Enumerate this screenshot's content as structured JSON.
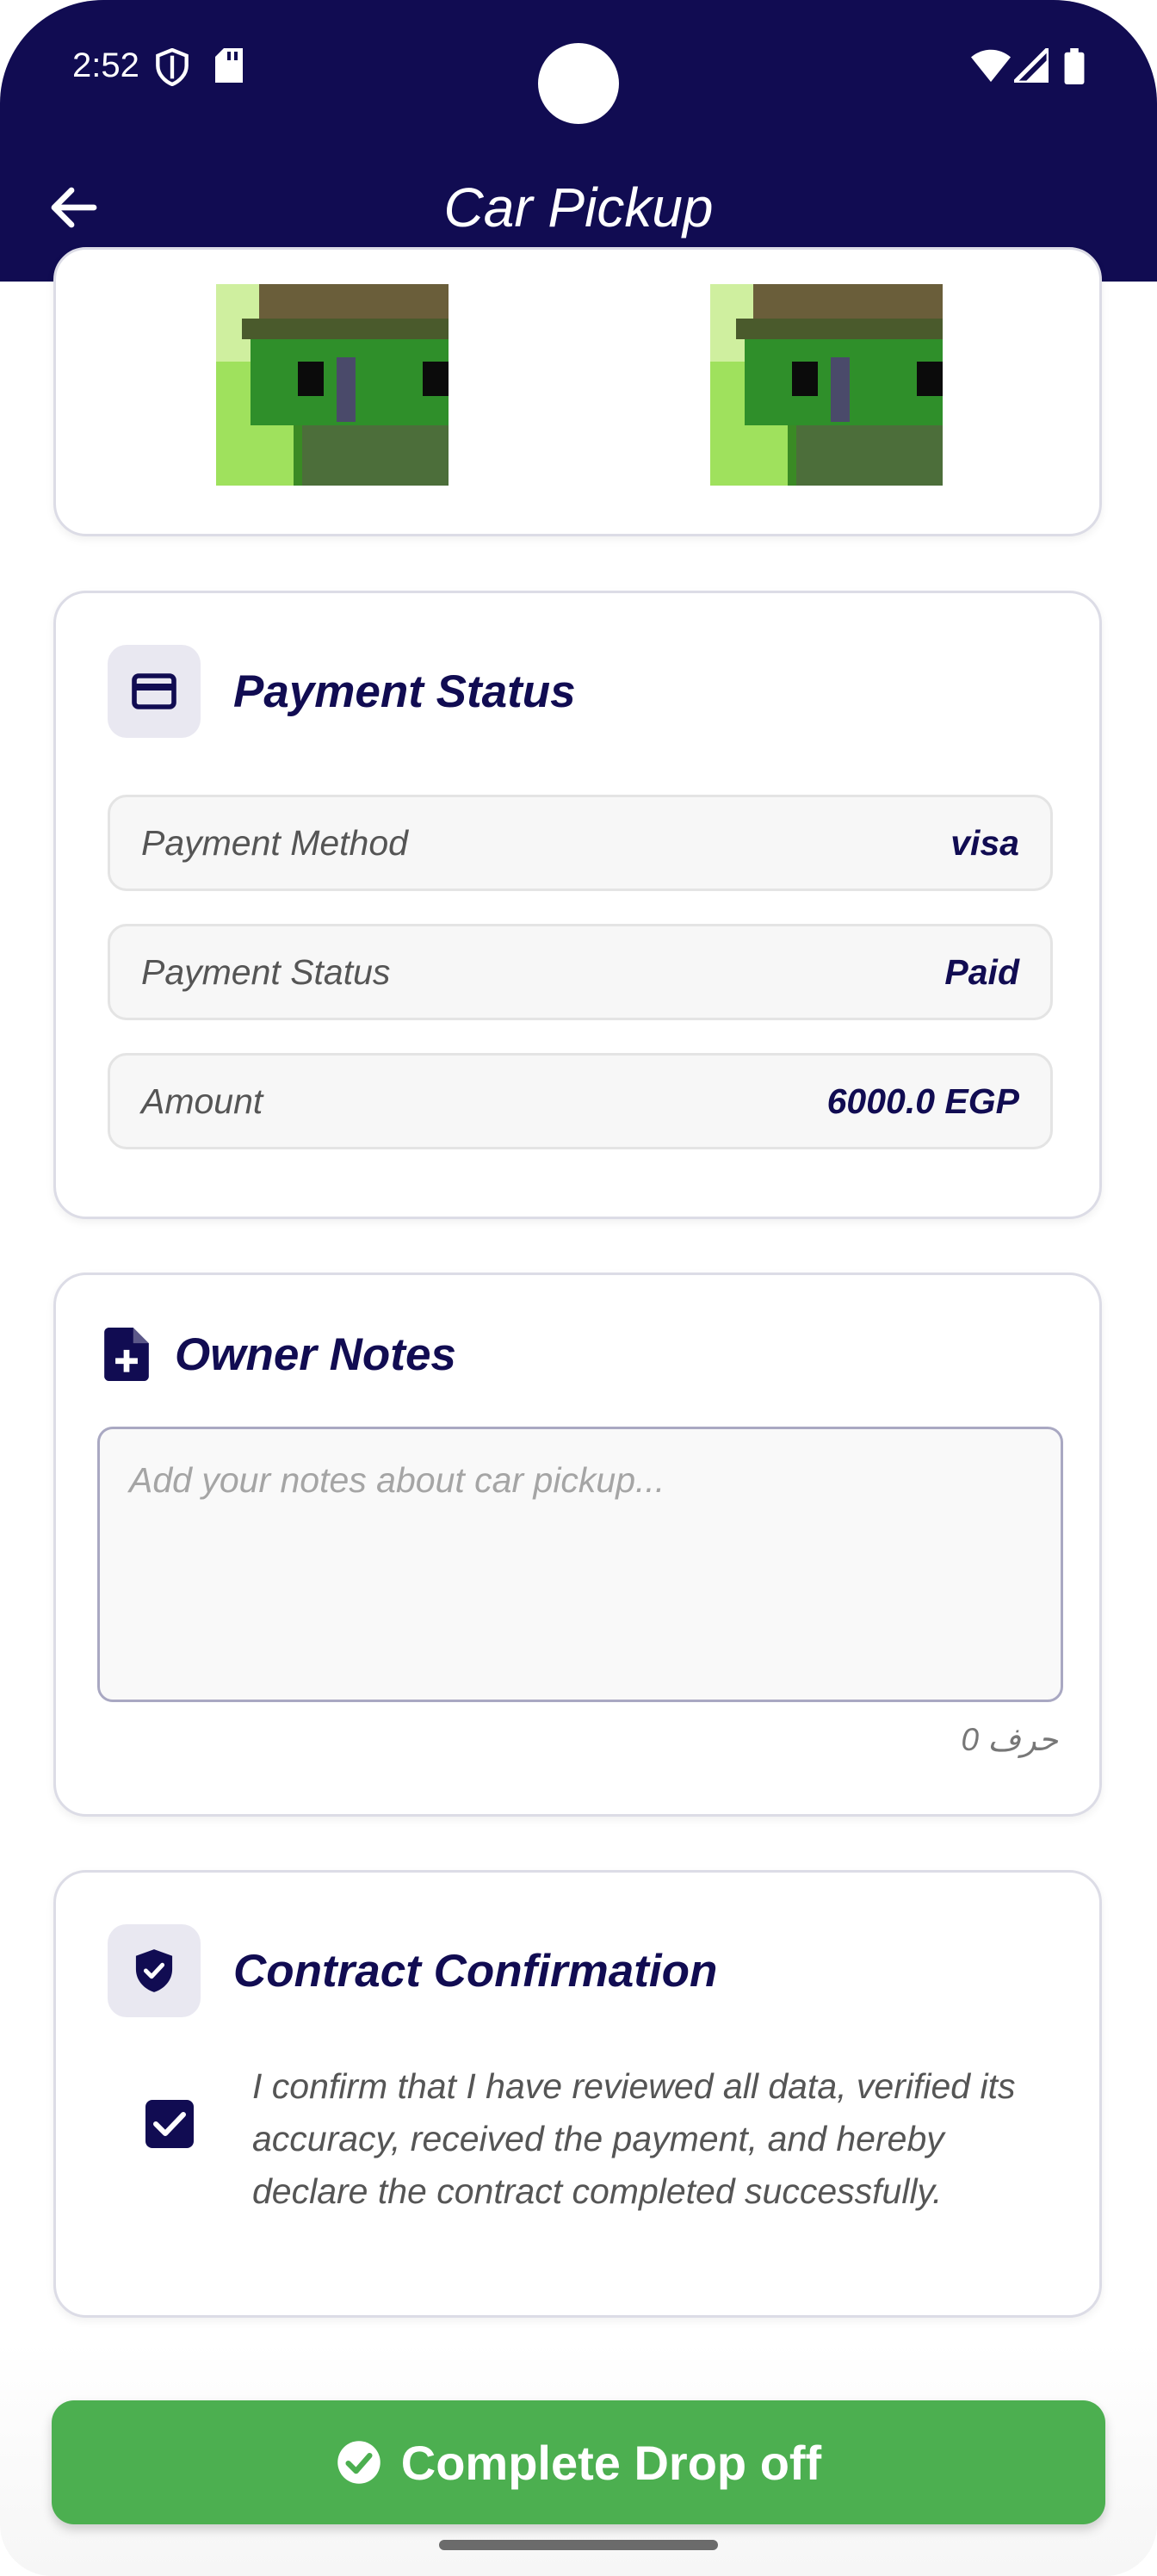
{
  "status_bar": {
    "time": "2:52"
  },
  "header": {
    "title": "Car Pickup"
  },
  "payment": {
    "title": "Payment Status",
    "rows": [
      {
        "label": "Payment Method",
        "value": "visa"
      },
      {
        "label": "Payment Status",
        "value": "Paid"
      },
      {
        "label": "Amount",
        "value": "6000.0 EGP"
      }
    ]
  },
  "notes": {
    "title": "Owner Notes",
    "placeholder": "Add your notes about car pickup...",
    "counter": "0 حرف"
  },
  "contract": {
    "title": "Contract Confirmation",
    "checked": true,
    "text": "I confirm that I have reviewed all data, verified its accuracy, received the payment, and hereby declare the contract completed successfully."
  },
  "action": {
    "label": "Complete Drop off"
  },
  "colors": {
    "primary": "#110c52",
    "success": "#4caf50"
  }
}
